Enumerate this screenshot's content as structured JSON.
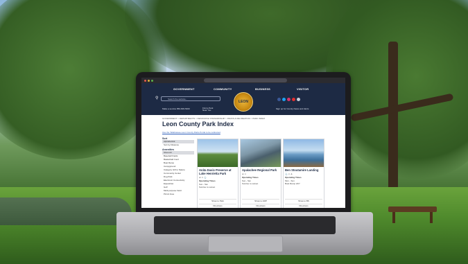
{
  "site": {
    "nav": [
      "GOVERNMENT",
      "COMMUNITY",
      "BUSINESS",
      "VISITOR"
    ],
    "search_placeholder": "Search the website...",
    "header_left_text": "Make a service 850-606-5300",
    "header_mid_text": "Find a Park Near You",
    "header_right_text": "Sign up for County News and Alerts",
    "logo_text": "LEON"
  },
  "page": {
    "breadcrumb": "GOVERNMENT > DEPARTMENTS > RESOURCE STEWARDSHIP > PARKS & RECREATION > PARK INDEX",
    "title": "Leon County Park Index",
    "intro_link": "Use the Tallahassee-Leon County Parks Portal to be redirected"
  },
  "sidebar": {
    "sort_heading": "Sort",
    "sort_items": [
      "Alphabetical",
      "Sort by Distance"
    ],
    "amenities_heading": "Amenities",
    "amenity_items": [
      "Show All",
      "Baseball Fields",
      "Basketball Court",
      "Boat Ramp",
      "Campground",
      "Category Gift to Nature",
      "Community Center",
      "Dog Park",
      "Electronic Connectivity",
      "Equestrian",
      "Golf",
      "Multi-purpose Field",
      "Picnic Area"
    ]
  },
  "cards": [
    {
      "title": "Anita Davis Preserve at Lake Henrietta Park",
      "icons": "♙ ♲ ⚓",
      "hours_label": "Operating Times",
      "hours": "Sun - Sat\nSunrise to sunset",
      "button1": "Show to Park",
      "button2": "Directions"
    },
    {
      "title": "Apalachee Regional Park",
      "icons": "♙ ♲",
      "hours_label": "Operating Times",
      "hours": "Sun - Sat\nSunrise to sunset",
      "button1": "Show to ARP",
      "button2": "Directions"
    },
    {
      "title": "Ben Stoutamire Landing",
      "icons": "⚓ ♲ ♙",
      "hours_label": "Operating Times",
      "hours": "Mon - Sun\nBoat Ramp 24/7",
      "button1": "Show to BS",
      "button2": "Directions"
    }
  ],
  "colors": {
    "header_bg": "#1d2a44",
    "title": "#1d2a44",
    "logo_gold": "#e7b43a"
  }
}
